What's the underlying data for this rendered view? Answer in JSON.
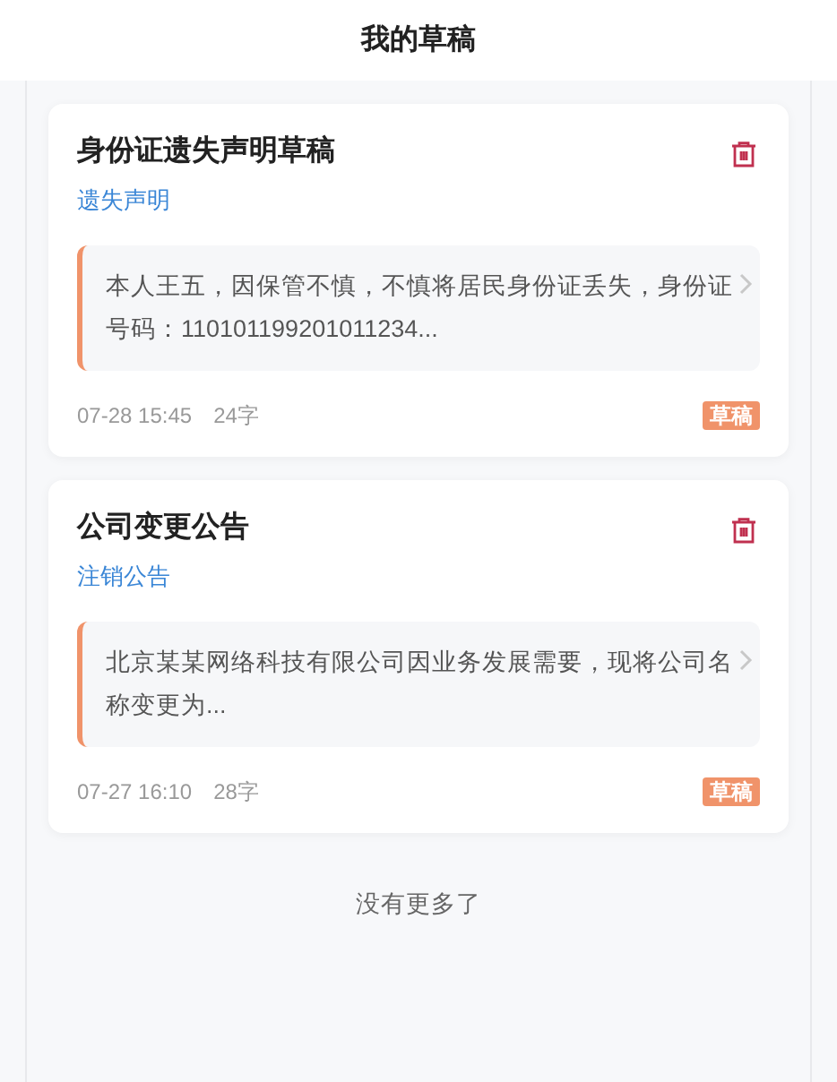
{
  "header": {
    "title": "我的草稿"
  },
  "drafts": [
    {
      "title": "身份证遗失声明草稿",
      "category": "遗失声明",
      "excerpt": "本人王五，因保管不慎，不慎将居民身份证丢失，身份证号码：110101199201011234...",
      "time": "07-28 15:45",
      "count": "24字",
      "status": "草稿"
    },
    {
      "title": "公司变更公告",
      "category": "注销公告",
      "excerpt": "北京某某网络科技有限公司因业务发展需要，现将公司名称变更为...",
      "time": "07-27 16:10",
      "count": "28字",
      "status": "草稿"
    }
  ],
  "footer": "没有更多了"
}
